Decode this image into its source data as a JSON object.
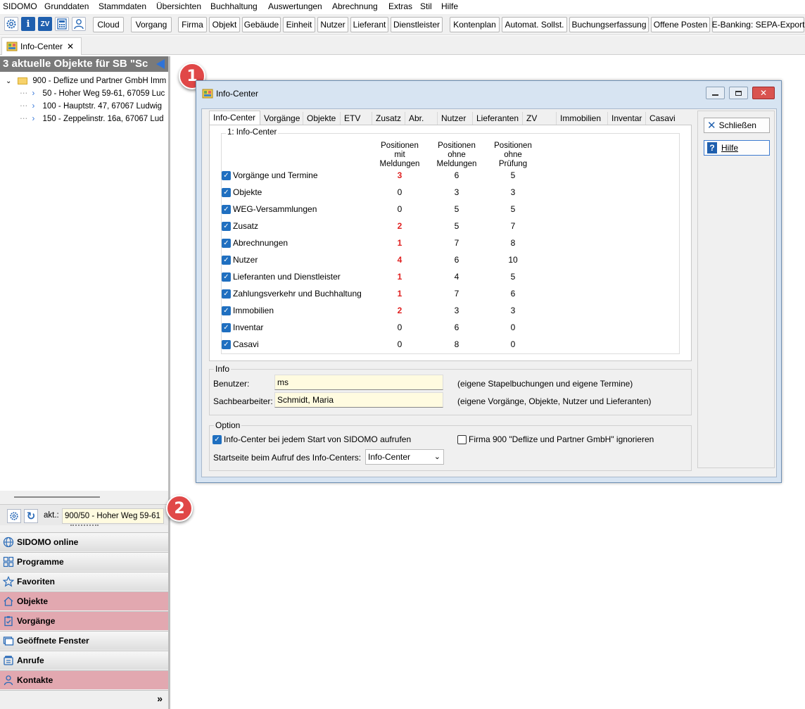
{
  "menu": [
    "SIDOMO",
    "Grunddaten",
    "Stammdaten",
    "Übersichten",
    "Buchhaltung",
    "Auswertungen",
    "Abrechnung",
    "Extras",
    "Stil",
    "Hilfe"
  ],
  "toolbar": {
    "icons": [
      "gear-icon",
      "info-icon",
      "zv-icon",
      "calculator-icon",
      "user-icon"
    ],
    "zv_icon_label": "ZV",
    "info_icon_label": "i",
    "buttons": [
      "Cloud",
      "Vorgang",
      "Firma",
      "Objekt",
      "Gebäude",
      "Einheit",
      "Nutzer",
      "Lieferant",
      "Dienstleister",
      "Kontenplan",
      "Automat. Sollst.",
      "Buchungserfassung",
      "Offene Posten",
      "E-Banking: SEPA-Export"
    ]
  },
  "doc_tab": {
    "label": "Info-Center",
    "close": "✕"
  },
  "left_panel": {
    "title": "3 aktuelle Objekte für SB \"Sc",
    "tree": {
      "root": "900 - Deflize und Partner GmbH Imm",
      "children": [
        "50 - Hoher Weg 59-61, 67059 Luc",
        "100 - Hauptstr. 47, 67067 Ludwig",
        "150 - Zeppelinstr. 16a, 67067 Lud"
      ]
    },
    "status": {
      "akt_label": "akt.:",
      "akt_value": "900/50 - Hoher Weg 59-61"
    },
    "nav": [
      {
        "label": "SIDOMO online",
        "icon": "globe-icon",
        "highlight": false
      },
      {
        "label": "Programme",
        "icon": "grid-icon",
        "highlight": false
      },
      {
        "label": "Favoriten",
        "icon": "star-icon",
        "highlight": false
      },
      {
        "label": "Objekte",
        "icon": "house-icon",
        "highlight": true
      },
      {
        "label": "Vorgänge",
        "icon": "clipboard-icon",
        "highlight": true
      },
      {
        "label": "Geöffnete Fenster",
        "icon": "windows-icon",
        "highlight": false
      },
      {
        "label": "Anrufe",
        "icon": "phone-icon",
        "highlight": false
      },
      {
        "label": "Kontakte",
        "icon": "person-icon",
        "highlight": true
      }
    ],
    "more_chevron": "»"
  },
  "callouts": [
    "1",
    "2"
  ],
  "dialog": {
    "title": "Info-Center",
    "tabs": [
      "Info-Center",
      "Vorgänge",
      "Objekte",
      "ETV",
      "Zusatz",
      "Abr.",
      "Nutzer",
      "Lieferanten",
      "ZV",
      "Immobilien",
      "Inventar",
      "Casavi"
    ],
    "active_tab": 0,
    "group_title": "1: Info-Center",
    "columns": [
      "Positionen\nmit\nMeldungen",
      "Positionen\nohne\nMeldungen",
      "Positionen\nohne\nPrüfung"
    ],
    "rows": [
      {
        "label": "Vorgänge und Termine",
        "checked": true,
        "mit": "3",
        "ohne": "6",
        "pruefung": "5",
        "alert": true
      },
      {
        "label": "Objekte",
        "checked": true,
        "mit": "0",
        "ohne": "3",
        "pruefung": "3",
        "alert": false
      },
      {
        "label": "WEG-Versammlungen",
        "checked": true,
        "mit": "0",
        "ohne": "5",
        "pruefung": "5",
        "alert": false
      },
      {
        "label": "Zusatz",
        "checked": true,
        "mit": "2",
        "ohne": "5",
        "pruefung": "7",
        "alert": true
      },
      {
        "label": "Abrechnungen",
        "checked": true,
        "mit": "1",
        "ohne": "7",
        "pruefung": "8",
        "alert": true
      },
      {
        "label": "Nutzer",
        "checked": true,
        "mit": "4",
        "ohne": "6",
        "pruefung": "10",
        "alert": true
      },
      {
        "label": "Lieferanten und Dienstleister",
        "checked": true,
        "mit": "1",
        "ohne": "4",
        "pruefung": "5",
        "alert": true
      },
      {
        "label": "Zahlungsverkehr und Buchhaltung",
        "checked": true,
        "mit": "1",
        "ohne": "7",
        "pruefung": "6",
        "alert": true
      },
      {
        "label": "Immobilien",
        "checked": true,
        "mit": "2",
        "ohne": "3",
        "pruefung": "3",
        "alert": true
      },
      {
        "label": "Inventar",
        "checked": true,
        "mit": "0",
        "ohne": "6",
        "pruefung": "0",
        "alert": false
      },
      {
        "label": "Casavi",
        "checked": true,
        "mit": "0",
        "ohne": "8",
        "pruefung": "0",
        "alert": false
      }
    ],
    "info": {
      "title": "Info",
      "benutzer_label": "Benutzer:",
      "benutzer_value": "ms",
      "benutzer_hint": "(eigene Stapelbuchungen und eigene Termine)",
      "sachbearbeiter_label": "Sachbearbeiter:",
      "sachbearbeiter_value": "Schmidt, Maria",
      "sachbearbeiter_hint": "(eigene Vorgänge, Objekte, Nutzer und Lieferanten)"
    },
    "option": {
      "title": "Option",
      "start_checkbox": "Info-Center bei jedem Start von SIDOMO aufrufen",
      "start_checked": true,
      "ignore_checkbox": "Firma 900 \"Deflize und Partner GmbH\" ignorieren",
      "ignore_checked": false,
      "startseite_label": "Startseite beim Aufruf des Info-Centers:",
      "startseite_value": "Info-Center"
    },
    "buttons": {
      "close": "Schließen",
      "help": "Hilfe"
    }
  },
  "colors": {
    "accent": "#1f6fc0",
    "alert_red": "#e02020",
    "highlight_nav": "#e2a8b0",
    "field_yellow": "#fffbe0",
    "dialog_frame": "#d7e4f2",
    "callout": "#e04848"
  }
}
